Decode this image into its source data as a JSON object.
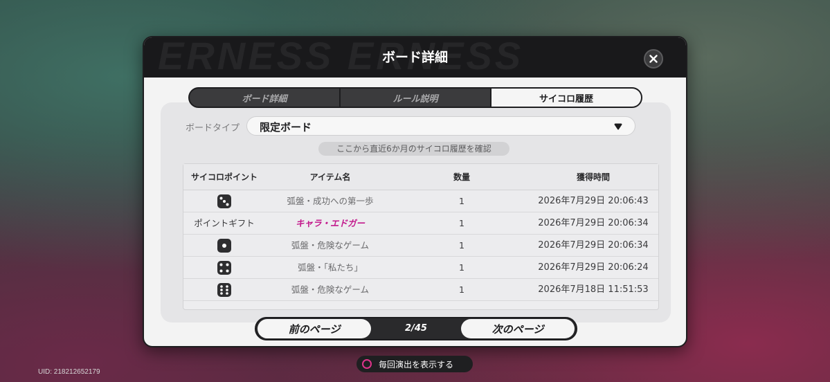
{
  "modal": {
    "title": "ボード詳細",
    "header_deco": "ERNESS ERNESS"
  },
  "tabs": [
    {
      "label": "ボード詳細",
      "active": false
    },
    {
      "label": "ルール説明",
      "active": false
    },
    {
      "label": "サイコロ履歴",
      "active": true
    }
  ],
  "board_type": {
    "label": "ボードタイプ",
    "selected": "限定ボード"
  },
  "notice": "ここから直近6か月のサイコロ履歴を確認",
  "table": {
    "headers": [
      "サイコロポイント",
      "アイテム名",
      "数量",
      "獲得時間"
    ],
    "rows": [
      {
        "point": "dice-face-3",
        "point_text": "",
        "item": "弧盤・成功への第一歩",
        "item_highlight": false,
        "qty": "1",
        "time": "2026年7月29日 20:06:43"
      },
      {
        "point": "",
        "point_text": "ポイントギフト",
        "item": "キャラ・エドガー",
        "item_highlight": true,
        "qty": "1",
        "time": "2026年7月29日 20:06:34"
      },
      {
        "point": "dice-face-1",
        "point_text": "",
        "item": "弧盤・危険なゲーム",
        "item_highlight": false,
        "qty": "1",
        "time": "2026年7月29日 20:06:34"
      },
      {
        "point": "dice-face-4",
        "point_text": "",
        "item": "弧盤・「私たち」",
        "item_highlight": false,
        "qty": "1",
        "time": "2026年7月29日 20:06:24"
      },
      {
        "point": "dice-face-6",
        "point_text": "",
        "item": "弧盤・危険なゲーム",
        "item_highlight": false,
        "qty": "1",
        "time": "2026年7月18日 11:51:53"
      }
    ]
  },
  "pager": {
    "prev_label": "前のページ",
    "page": "2/45",
    "next_label": "次のページ"
  },
  "footer": {
    "uid": "UID: 218212652179",
    "show_effect_label": "毎回演出を表示する"
  },
  "colors": {
    "highlight": "#c2178b",
    "accent_circle": "#e0338a"
  }
}
